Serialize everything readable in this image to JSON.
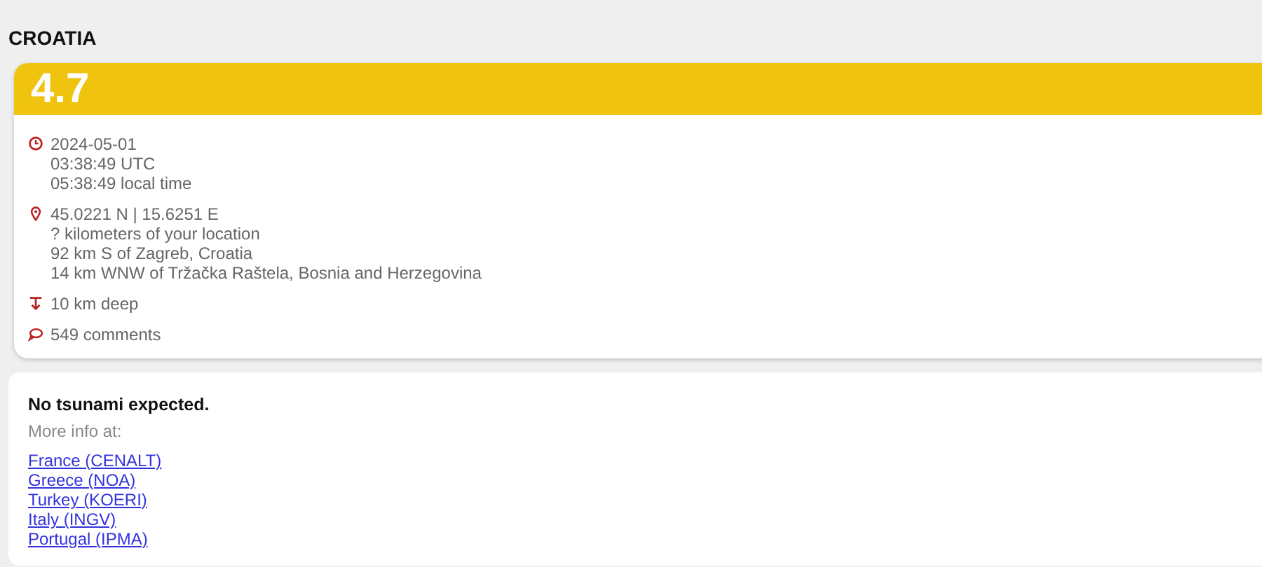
{
  "region": "CROATIA",
  "magnitude": "4.7",
  "details": [
    {
      "kind": "time",
      "lines": [
        "2024-05-01",
        "03:38:49 UTC",
        "05:38:49 local time"
      ]
    },
    {
      "kind": "location",
      "lines": [
        "45.0221 N | 15.6251 E",
        "? kilometers of your location",
        "92 km S of Zagreb, Croatia",
        "14 km WNW of Tržačka Raštela, Bosnia and Herzegovina"
      ]
    },
    {
      "kind": "depth",
      "lines": [
        "10 km deep"
      ]
    },
    {
      "kind": "comments",
      "lines": [
        "549 comments"
      ]
    }
  ],
  "tsunami": {
    "message": "No tsunami expected.",
    "more_info": "More info at:",
    "links": [
      "France (CENALT)",
      "Greece (NOA)",
      "Turkey (KOERI)",
      "Italy (INGV)",
      "Portugal (IPMA)"
    ]
  }
}
